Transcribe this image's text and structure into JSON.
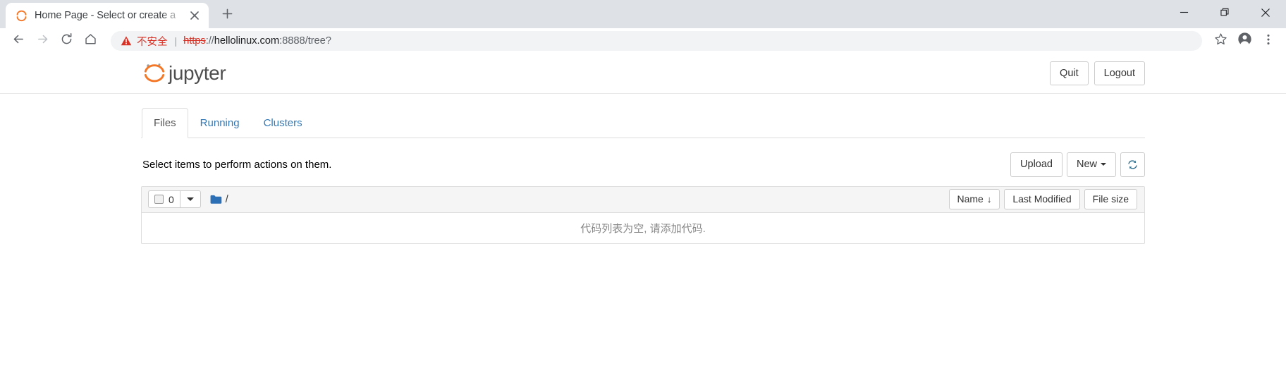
{
  "browser": {
    "tab": {
      "title": "Home Page - Select or create a",
      "favicon_icon": "jupyter-favicon",
      "close_icon": "close-icon"
    },
    "new_tab_icon": "plus-icon",
    "window_controls": {
      "minimize_icon": "minimize-icon",
      "maximize_icon": "restore-icon",
      "close_icon": "window-close-icon"
    },
    "toolbar": {
      "back_icon": "back-arrow-icon",
      "forward_icon": "forward-arrow-icon",
      "reload_icon": "reload-icon",
      "home_icon": "home-icon",
      "bookmark_icon": "star-icon",
      "profile_icon": "account-avatar-icon",
      "menu_icon": "three-dot-menu-icon"
    },
    "omnibox": {
      "warning_icon": "warning-triangle-icon",
      "insecure_label": "不安全",
      "separator": "|",
      "url_scheme": "https",
      "url_scheme_suffix": "://",
      "url_host": "hellolinux.com",
      "url_port": ":8888",
      "url_path": "/tree?"
    }
  },
  "jupyter": {
    "logo_text": "jupyter",
    "logo_icon": "jupyter-logo-icon",
    "header_buttons": [
      {
        "label": "Quit",
        "name": "quit-button"
      },
      {
        "label": "Logout",
        "name": "logout-button"
      }
    ],
    "tabs": [
      {
        "label": "Files",
        "active": true
      },
      {
        "label": "Running",
        "active": false
      },
      {
        "label": "Clusters",
        "active": false
      }
    ],
    "action_row": {
      "text": "Select items to perform actions on them.",
      "upload_label": "Upload",
      "new_label": "New",
      "refresh_icon": "refresh-icon"
    },
    "list_header": {
      "checkbox_icon": "select-all-checkbox",
      "selected_count": "0",
      "dropdown_icon": "chevron-down-icon",
      "folder_icon": "folder-icon",
      "breadcrumb_path": "/",
      "sort_buttons": [
        {
          "label": "Name",
          "arrow": "↓",
          "name": "sort-by-name-button"
        },
        {
          "label": "Last Modified",
          "arrow": "",
          "name": "sort-by-last-modified-button"
        },
        {
          "label": "File size",
          "arrow": "",
          "name": "sort-by-file-size-button"
        }
      ]
    },
    "empty_message": "代码列表为空, 请添加代码.",
    "colors": {
      "brand_orange": "#f37726",
      "link_blue": "#337ab7",
      "insecure_red": "#d93025",
      "folder_blue": "#2c6fb5"
    }
  }
}
